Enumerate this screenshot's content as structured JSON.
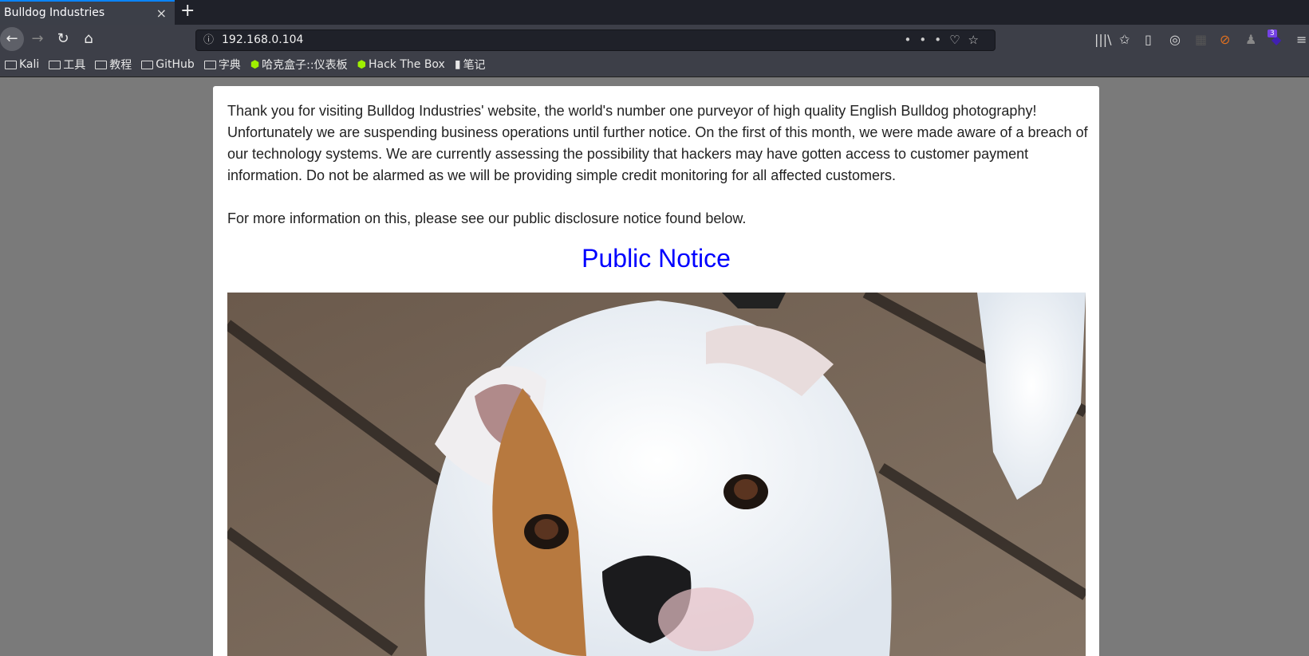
{
  "browser": {
    "tab_title": "Bulldog Industries",
    "new_tab": "+",
    "close": "×",
    "url": "192.168.0.104",
    "extension_badge": "3"
  },
  "bookmarks": [
    {
      "label": "Kali",
      "icon": "folder-icon"
    },
    {
      "label": "工具",
      "icon": "folder-icon"
    },
    {
      "label": "教程",
      "icon": "folder-icon"
    },
    {
      "label": "GitHub",
      "icon": "folder-icon"
    },
    {
      "label": "字典",
      "icon": "folder-icon"
    },
    {
      "label": "哈克盒子::仪表板",
      "icon": "htb-cube-icon"
    },
    {
      "label": "Hack The Box",
      "icon": "htb-cube-icon"
    },
    {
      "label": "笔记",
      "icon": "document-icon"
    }
  ],
  "page": {
    "paragraph1": "Thank you for visiting Bulldog Industries' website, the world's number one purveyor of high quality English Bulldog photography! Unfortunately we are suspending business operations until further notice. On the first of this month, we were made aware of a breach of our technology systems. We are currently assessing the possibility that hackers may have gotten access to customer payment information. Do not be alarmed as we will be providing simple credit monitoring for all affected customers.",
    "paragraph2": "For more information on this, please see our public disclosure notice found below.",
    "heading": "Public Notice"
  }
}
